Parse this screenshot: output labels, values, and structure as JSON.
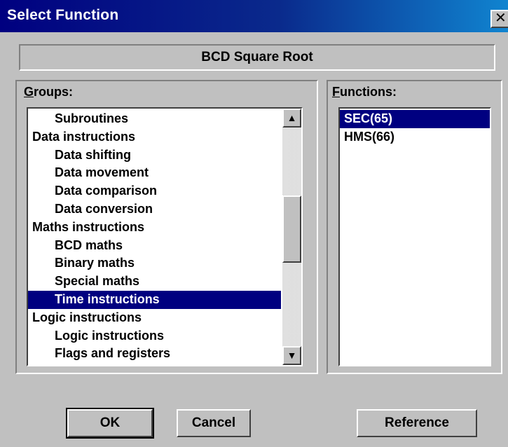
{
  "window": {
    "title": "Select Function",
    "close_symbol": "✕"
  },
  "selected_function_name": "BCD Square Root",
  "groups": {
    "label_accel": "G",
    "label_rest": "roups:",
    "items": [
      {
        "label": "Subroutines",
        "indent": true,
        "selected": false
      },
      {
        "label": "Data instructions",
        "indent": false,
        "selected": false
      },
      {
        "label": "Data shifting",
        "indent": true,
        "selected": false
      },
      {
        "label": "Data movement",
        "indent": true,
        "selected": false
      },
      {
        "label": "Data comparison",
        "indent": true,
        "selected": false
      },
      {
        "label": "Data conversion",
        "indent": true,
        "selected": false
      },
      {
        "label": "Maths instructions",
        "indent": false,
        "selected": false
      },
      {
        "label": "BCD maths",
        "indent": true,
        "selected": false
      },
      {
        "label": "Binary maths",
        "indent": true,
        "selected": false
      },
      {
        "label": "Special maths",
        "indent": true,
        "selected": false
      },
      {
        "label": "Time instructions",
        "indent": true,
        "selected": true
      },
      {
        "label": "Logic instructions",
        "indent": false,
        "selected": false
      },
      {
        "label": "Logic instructions",
        "indent": true,
        "selected": false
      },
      {
        "label": "Flags and registers",
        "indent": true,
        "selected": false
      }
    ],
    "scroll_position": 0.45
  },
  "functions": {
    "label_accel": "F",
    "label_rest": "unctions:",
    "items": [
      {
        "label": "SEC(65)",
        "indent": false,
        "selected": true
      },
      {
        "label": "HMS(66)",
        "indent": false,
        "selected": false
      }
    ]
  },
  "buttons": {
    "ok": "OK",
    "cancel": "Cancel",
    "reference": "Reference"
  },
  "colors": {
    "selection": "#000080",
    "titlebar": "#000080",
    "face": "#c0c0c0"
  },
  "icons": {
    "scroll_up": "▲",
    "scroll_down": "▼"
  }
}
